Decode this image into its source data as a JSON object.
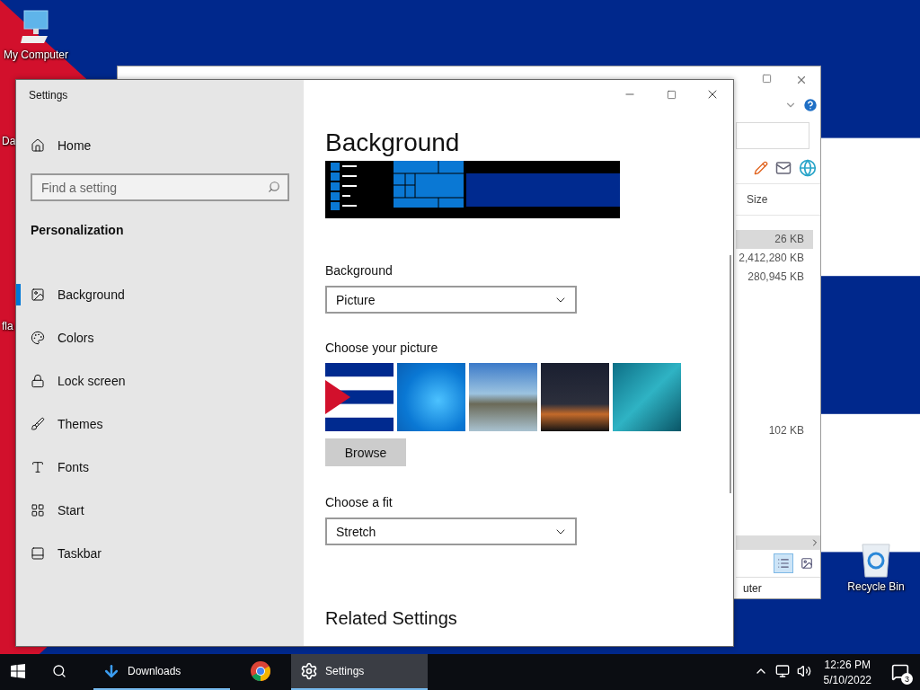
{
  "desktop_icons": [
    {
      "kind": "computer",
      "label": "My Computer"
    },
    {
      "kind": "partial",
      "label": "Da"
    },
    {
      "kind": "partial",
      "label": "fla"
    },
    {
      "kind": "recycle",
      "label": "Recycle Bin"
    }
  ],
  "explorer": {
    "column": "Size",
    "groups": [
      {
        "rows": [
          {
            "size": "26 KB",
            "selected": true
          },
          {
            "size": "2,412,280 KB",
            "selected": false
          },
          {
            "size": "280,945 KB",
            "selected": false
          }
        ]
      },
      {
        "rows": [
          {
            "size": "102 KB",
            "selected": false
          }
        ]
      }
    ],
    "status": "uter"
  },
  "settings": {
    "title": "Settings",
    "home": "Home",
    "search": {
      "placeholder": "Find a setting"
    },
    "section": "Personalization",
    "nav": [
      {
        "kind": "background",
        "label": "Background",
        "selected": true
      },
      {
        "kind": "colors",
        "label": "Colors",
        "selected": false
      },
      {
        "kind": "lock",
        "label": "Lock screen",
        "selected": false
      },
      {
        "kind": "themes",
        "label": "Themes",
        "selected": false
      },
      {
        "kind": "fonts",
        "label": "Fonts",
        "selected": false
      },
      {
        "kind": "start",
        "label": "Start",
        "selected": false
      },
      {
        "kind": "taskbar",
        "label": "Taskbar",
        "selected": false
      }
    ],
    "page_title": "Background",
    "background": {
      "label": "Background",
      "value": "Picture"
    },
    "pictures_label": "Choose your picture",
    "pictures": [
      {
        "kind": "flag"
      },
      {
        "kind": "windows"
      },
      {
        "kind": "beach"
      },
      {
        "kind": "night"
      },
      {
        "kind": "underwater"
      }
    ],
    "browse": "Browse",
    "fit": {
      "label": "Choose a fit",
      "value": "Stretch"
    },
    "related": "Related Settings"
  },
  "taskbar": {
    "apps": [
      {
        "kind": "downloads",
        "label": "Downloads",
        "selected": false
      },
      {
        "kind": "chrome",
        "selected": false
      },
      {
        "kind": "settings",
        "label": "Settings",
        "selected": true
      }
    ],
    "time": "12:26 PM",
    "date": "5/10/2022",
    "notifications": "3"
  }
}
